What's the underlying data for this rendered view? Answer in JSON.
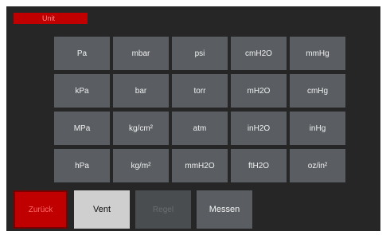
{
  "header": {
    "title": "Unit"
  },
  "units": [
    [
      "Pa",
      "mbar",
      "psi",
      "cmH2O",
      "mmHg"
    ],
    [
      "kPa",
      "bar",
      "torr",
      "mH2O",
      "cmHg"
    ],
    [
      "MPa",
      "kg/cm²",
      "atm",
      "inH2O",
      "inHg"
    ],
    [
      "hPa",
      "kg/m²",
      "mmH2O",
      "ftH2O",
      "oz/in²"
    ]
  ],
  "buttons": {
    "back": "Zurück",
    "vent": "Vent",
    "regel": "Regel",
    "messen": "Messen"
  },
  "colors": {
    "background": "#262626",
    "unit_button": "#5a5e62",
    "accent_red": "#c00000",
    "vent_button": "#cfcfcf",
    "disabled_button": "#4a4d50"
  }
}
